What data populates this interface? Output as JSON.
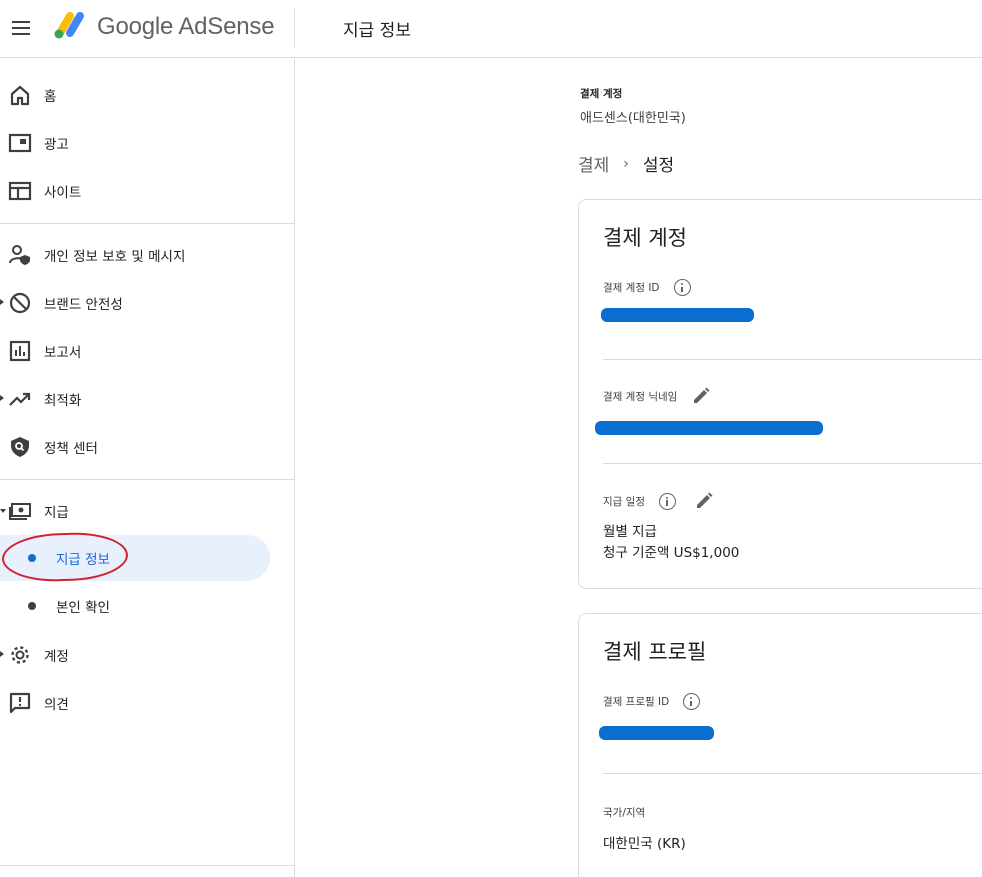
{
  "header": {
    "brand": "Google AdSense",
    "page_title": "지급 정보"
  },
  "sidebar": {
    "items": [
      {
        "label": "홈",
        "icon": "home-icon"
      },
      {
        "label": "광고",
        "icon": "ads-icon"
      },
      {
        "label": "사이트",
        "icon": "sites-icon"
      },
      {
        "label": "개인 정보 보호 및 메시지",
        "icon": "privacy-icon"
      },
      {
        "label": "브랜드 안전성",
        "icon": "block-icon"
      },
      {
        "label": "보고서",
        "icon": "reports-icon"
      },
      {
        "label": "최적화",
        "icon": "trending-icon"
      },
      {
        "label": "정책 센터",
        "icon": "shield-icon"
      },
      {
        "label": "지급",
        "icon": "payments-icon"
      },
      {
        "label": "계정",
        "icon": "gear-icon"
      },
      {
        "label": "의견",
        "icon": "feedback-icon"
      }
    ],
    "payments_sub": [
      {
        "label": "지급 정보",
        "active": true
      },
      {
        "label": "본인 확인",
        "active": false
      }
    ]
  },
  "main": {
    "account_label": "결제 계정",
    "account_value": "애드센스(대한민국)",
    "breadcrumb": {
      "parent": "결제",
      "current": "설정"
    },
    "billing_account_card": {
      "title": "결제 계정",
      "id_label": "결제 계정 ID",
      "nickname_label": "결제 계정 닉네임",
      "schedule_label": "지급 일정",
      "schedule_value_1": "월별 지급",
      "schedule_value_2": "청구 기준액 US$1,000"
    },
    "billing_profile_card": {
      "title": "결제 프로필",
      "id_label": "결제 프로필 ID",
      "country_label": "국가/지역",
      "country_value": "대한민국 (KR)"
    }
  },
  "colors": {
    "accent": "#1967d2",
    "active_bg": "#e8f0fe",
    "redaction": "#0a6ed1",
    "annotation": "#d3202a"
  }
}
